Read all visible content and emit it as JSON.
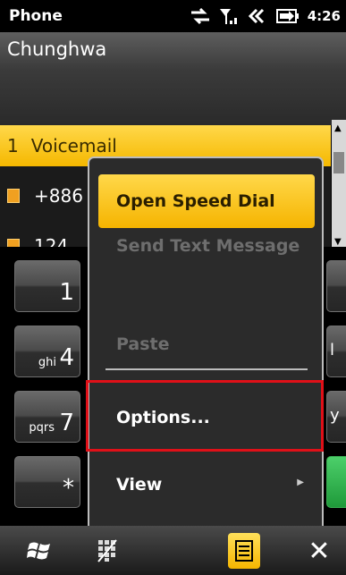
{
  "status_bar": {
    "title": "Phone",
    "time": "4:26",
    "icons": [
      "data-sync-icon",
      "signal-strength-icon",
      "speaker-volume-icon",
      "battery-charging-icon"
    ]
  },
  "header": {
    "carrier": "Chunghwa"
  },
  "call_list": {
    "items": [
      {
        "num": "1",
        "label": "Voicemail"
      },
      {
        "label": "+886"
      },
      {
        "label": "124"
      }
    ]
  },
  "keypad": {
    "keys": [
      {
        "digit": "1",
        "letters": ""
      },
      {
        "digit": "4",
        "letters": "ghi"
      },
      {
        "digit": "7",
        "letters": "pqrs"
      },
      {
        "digit": "*",
        "letters": ""
      }
    ],
    "right_edge_glyphs": [
      "",
      "l",
      "y",
      ""
    ]
  },
  "context_menu": {
    "items": [
      {
        "label": "Open Speed Dial",
        "state": "highlighted"
      },
      {
        "label": "Send Text Message",
        "state": "disabled"
      },
      {
        "label": "Paste",
        "state": "disabled"
      },
      {
        "label": "Options...",
        "state": "normal"
      },
      {
        "label": "View",
        "state": "normal",
        "has_submenu": true
      }
    ]
  },
  "bottom_bar": {
    "buttons": [
      "windows-start-icon",
      "keypad-toggle-icon",
      "menu-icon",
      "close-icon"
    ],
    "close_label": "✕"
  },
  "colors": {
    "accent": "#f5b800",
    "highlight_box": "#e01018"
  }
}
